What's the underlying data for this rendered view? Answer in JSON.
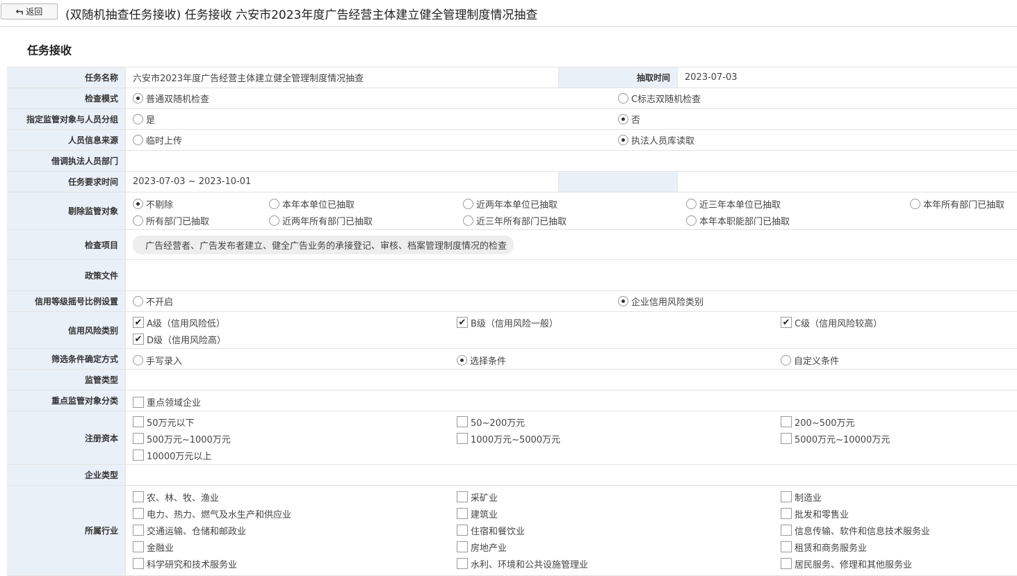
{
  "header": {
    "back_label": "返回",
    "title": "(双随机抽查任务接收) 任务接收 六安市2023年度广告经营主体建立健全管理制度情况抽查"
  },
  "section_title": "任务接收",
  "task_name": {
    "label": "任务名称",
    "value": "六安市2023年度广告经营主体建立健全管理制度情况抽查"
  },
  "draw_time": {
    "label": "抽取时间",
    "value": "2023-07-03"
  },
  "check_mode": {
    "label": "检查模式",
    "options": [
      "普通双随机检查",
      "C标志双随机检查"
    ]
  },
  "assign_group": {
    "label": "指定监管对象与人员分组",
    "options": [
      "是",
      "否"
    ]
  },
  "staff_source": {
    "label": "人员信息来源",
    "options": [
      "临时上传",
      "执法人员库读取"
    ]
  },
  "borrow_dept": {
    "label": "借调执法人员部门"
  },
  "required_time": {
    "label": "任务要求时间",
    "value": "2023-07-03 ~ 2023-10-01"
  },
  "exclude": {
    "label": "剔除监管对象",
    "options": [
      "不剔除",
      "本年本单位已抽取",
      "近两年本单位已抽取",
      "近三年本单位已抽取",
      "本年所有部门已抽取",
      "所有部门已抽取",
      "近两年所有部门已抽取",
      "近三年所有部门已抽取",
      "本年本职能部门已抽取"
    ]
  },
  "check_items": {
    "label": "检查项目",
    "tag": "广告经营者、广告发布者建立、健全广告业务的承接登记、审核、档案管理制度情况的检查"
  },
  "policy": {
    "label": "政策文件"
  },
  "credit_ratio": {
    "label": "信用等级摇号比例设置",
    "options": [
      "不开启",
      "企业信用风险类别"
    ]
  },
  "credit_risk": {
    "label": "信用风险类别",
    "options": [
      "A级（信用风险低）",
      "B级（信用风险一般）",
      "C级（信用风险较高）",
      "D级（信用风险高）"
    ]
  },
  "filter_mode": {
    "label": "筛选条件确定方式",
    "options": [
      "手写录入",
      "选择条件",
      "自定义条件"
    ]
  },
  "supervise_type": {
    "label": "监管类型"
  },
  "key_object": {
    "label": "重点监管对象分类",
    "options": [
      "重点领域企业"
    ]
  },
  "capital": {
    "label": "注册资本",
    "options": [
      "50万元以下",
      "50~200万元",
      "200~500万元",
      "500万元~1000万元",
      "1000万元~5000万元",
      "5000万元~10000万元",
      "10000万元以上"
    ]
  },
  "ent_type": {
    "label": "企业类型"
  },
  "industry": {
    "label": "所属行业",
    "options": [
      "农、林、牧、渔业",
      "采矿业",
      "制造业",
      "电力、热力、燃气及水生产和供应业",
      "建筑业",
      "批发和零售业",
      "交通运输、仓储和邮政业",
      "住宿和餐饮业",
      "信息传输、软件和信息技术服务业",
      "金融业",
      "房地产业",
      "租赁和商务服务业",
      "科学研究和技术服务业",
      "水利、环境和公共设施管理业",
      "居民服务、修理和其他服务业"
    ]
  }
}
